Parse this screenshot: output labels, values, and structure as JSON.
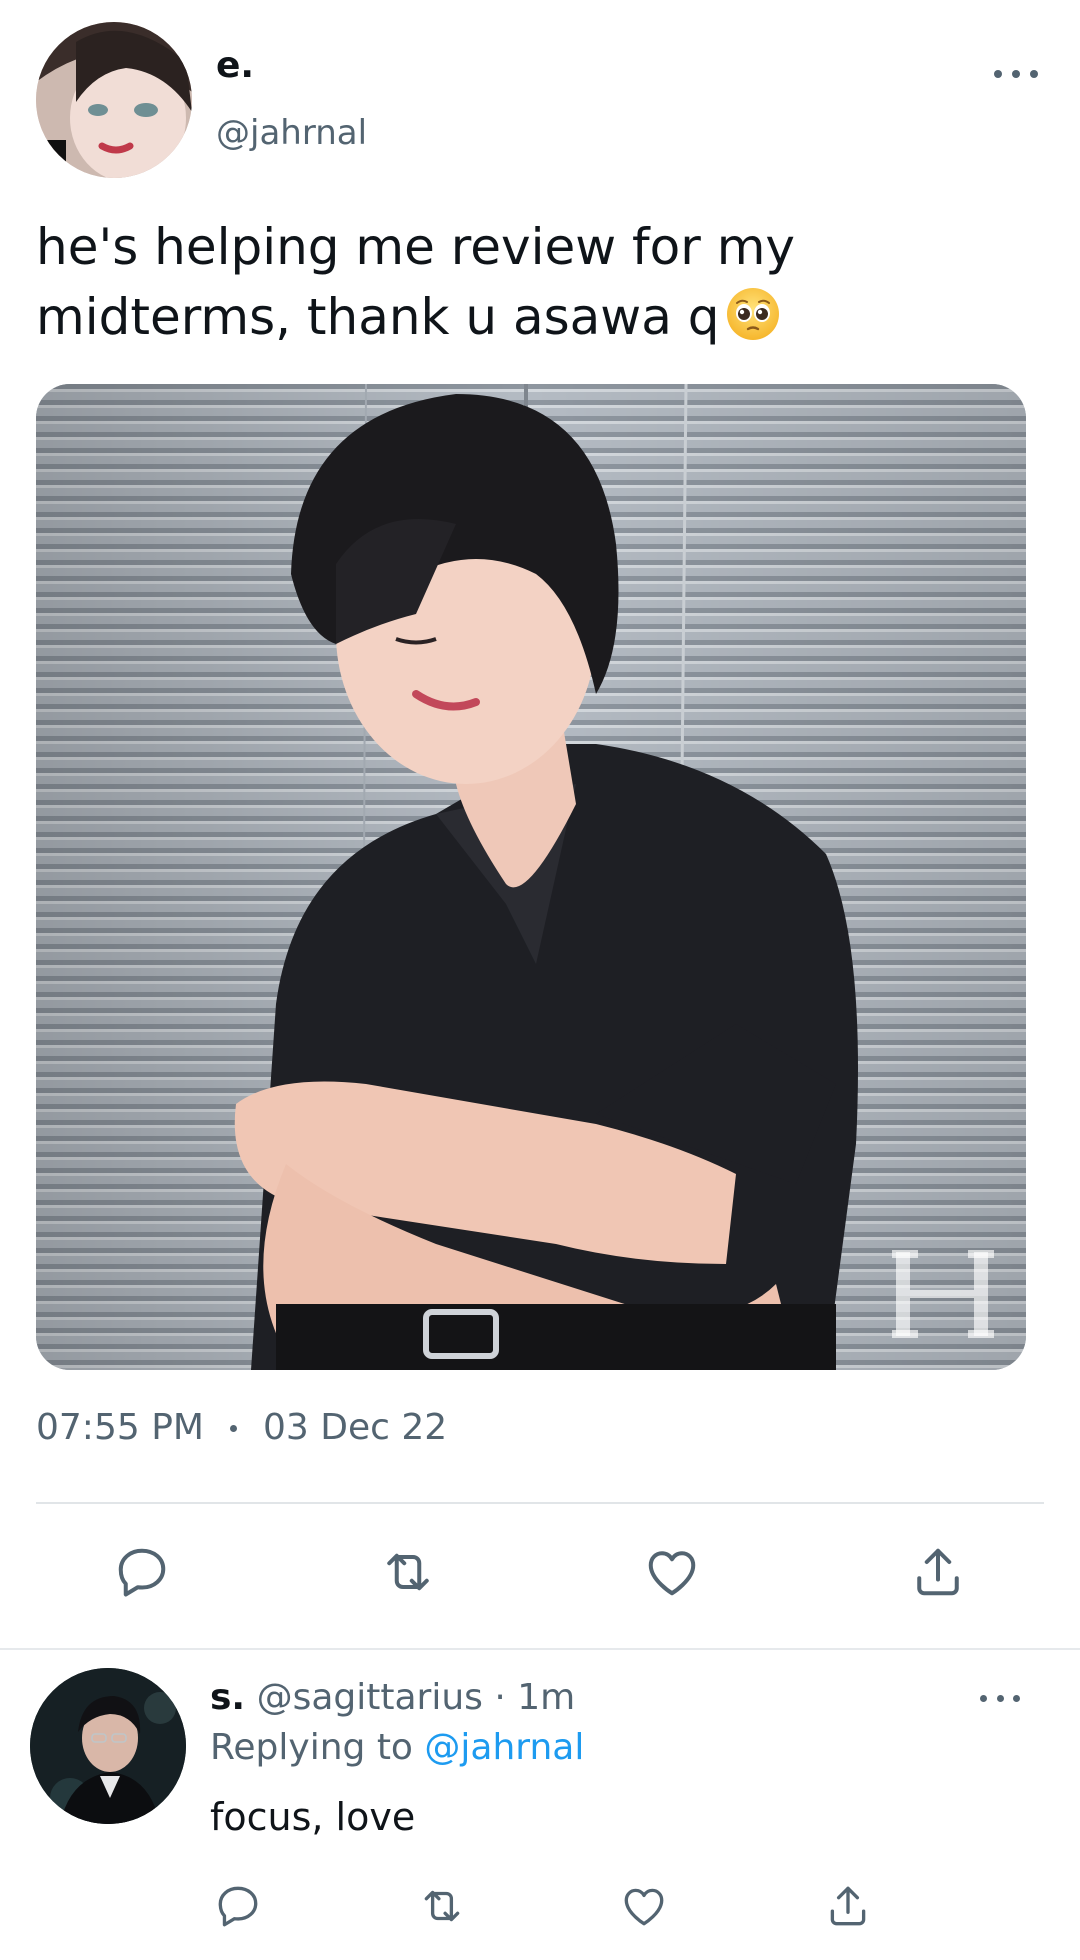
{
  "tweet": {
    "author_name": "e.",
    "author_handle": "@jahrnal",
    "text": "he's helping me review for my midterms, thank u asawa q",
    "emoji": "pleading-face",
    "time": "07:55 PM",
    "date": "03 Dec 22"
  },
  "reply": {
    "author_name": "s.",
    "author_handle": "@sagittarius",
    "separator": " · ",
    "age": "1m",
    "replying_prefix": "Replying to ",
    "replying_to": "@jahrnal",
    "text": "focus, love"
  },
  "icons": {
    "reply": "reply-icon",
    "retweet": "retweet-icon",
    "like": "heart-icon",
    "share": "share-icon",
    "more": "more-icon"
  },
  "colors": {
    "text_primary": "#0f1419",
    "text_secondary": "#536471",
    "link": "#1d9bf0",
    "divider": "#e1e5e8"
  }
}
